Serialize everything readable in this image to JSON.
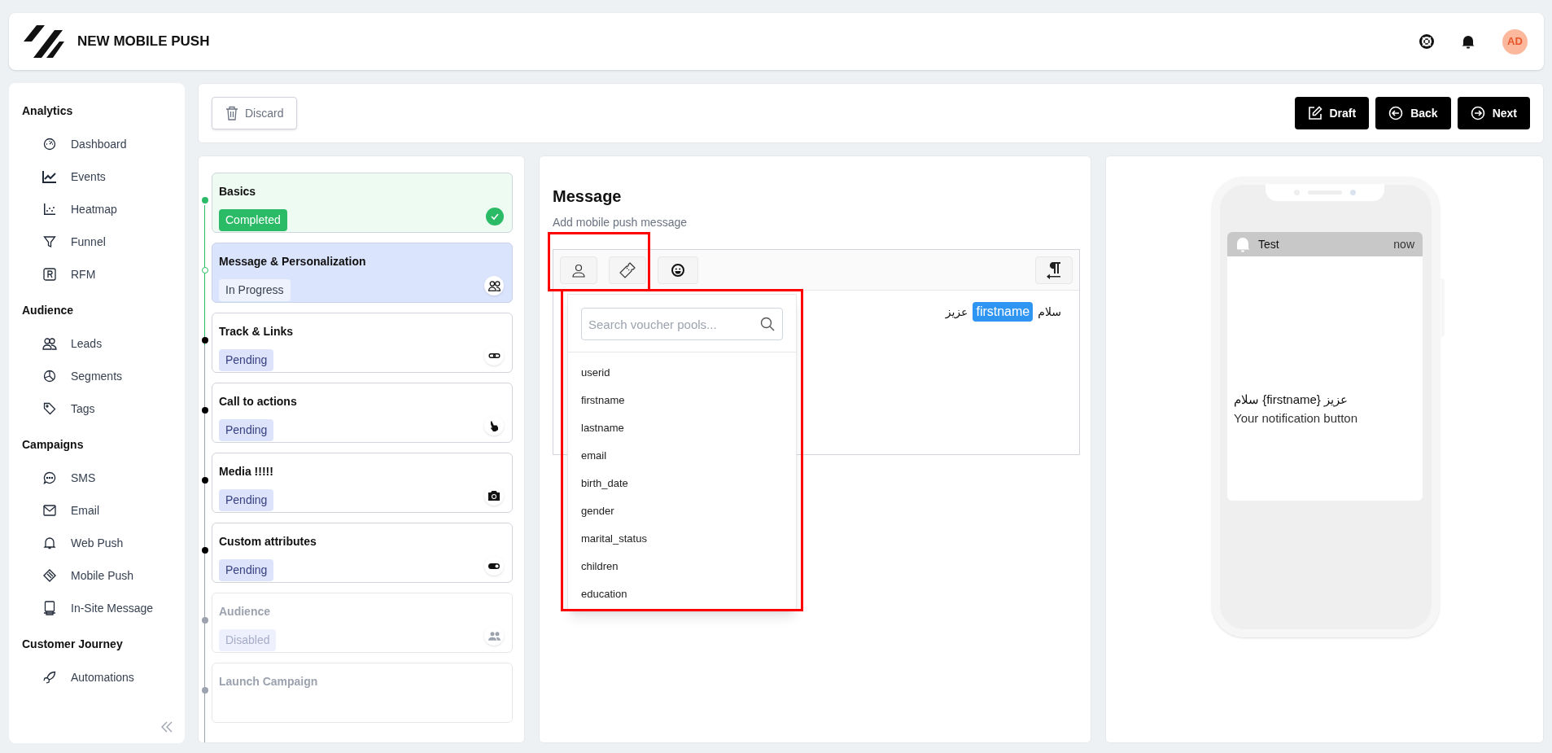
{
  "header": {
    "title": "NEW MOBILE PUSH",
    "avatar": "AD"
  },
  "sidebar": {
    "sections": [
      {
        "title": "Analytics",
        "items": [
          {
            "label": "Dashboard"
          },
          {
            "label": "Events"
          },
          {
            "label": "Heatmap"
          },
          {
            "label": "Funnel"
          },
          {
            "label": "RFM"
          }
        ]
      },
      {
        "title": "Audience",
        "items": [
          {
            "label": "Leads"
          },
          {
            "label": "Segments"
          },
          {
            "label": "Tags"
          }
        ]
      },
      {
        "title": "Campaigns",
        "items": [
          {
            "label": "SMS"
          },
          {
            "label": "Email"
          },
          {
            "label": "Web Push"
          },
          {
            "label": "Mobile Push"
          },
          {
            "label": "In-Site Message"
          }
        ]
      },
      {
        "title": "Customer Journey",
        "items": [
          {
            "label": "Automations"
          }
        ]
      }
    ]
  },
  "toolbar": {
    "discard": "Discard",
    "actions": [
      "Draft",
      "Back",
      "Next"
    ]
  },
  "steps": [
    {
      "title": "Basics",
      "status": "Completed",
      "kind": "completed"
    },
    {
      "title": "Message & Personalization",
      "status": "In Progress",
      "kind": "in_progress"
    },
    {
      "title": "Track & Links",
      "status": "Pending",
      "kind": "pending"
    },
    {
      "title": "Call to actions",
      "status": "Pending",
      "kind": "pending"
    },
    {
      "title": "Media !!!!!",
      "status": "Pending",
      "kind": "pending"
    },
    {
      "title": "Custom attributes",
      "status": "Pending",
      "kind": "pending"
    },
    {
      "title": "Audience",
      "status": "Disabled",
      "kind": "disabled"
    },
    {
      "title": "Launch Campaign",
      "kind": "disabled"
    }
  ],
  "message": {
    "title": "Message",
    "subtitle": "Add mobile push message",
    "editor": {
      "text_before": "سلام",
      "tag": "firstname",
      "text_after": "عزیز"
    },
    "dropdown": {
      "placeholder": "Search voucher pools...",
      "items": [
        "userid",
        "firstname",
        "lastname",
        "email",
        "birth_date",
        "gender",
        "marital_status",
        "children",
        "education"
      ]
    }
  },
  "preview": {
    "app": "Test",
    "time": "now",
    "title": "سلام {firstname} عزیز",
    "body": "Your notification button"
  }
}
